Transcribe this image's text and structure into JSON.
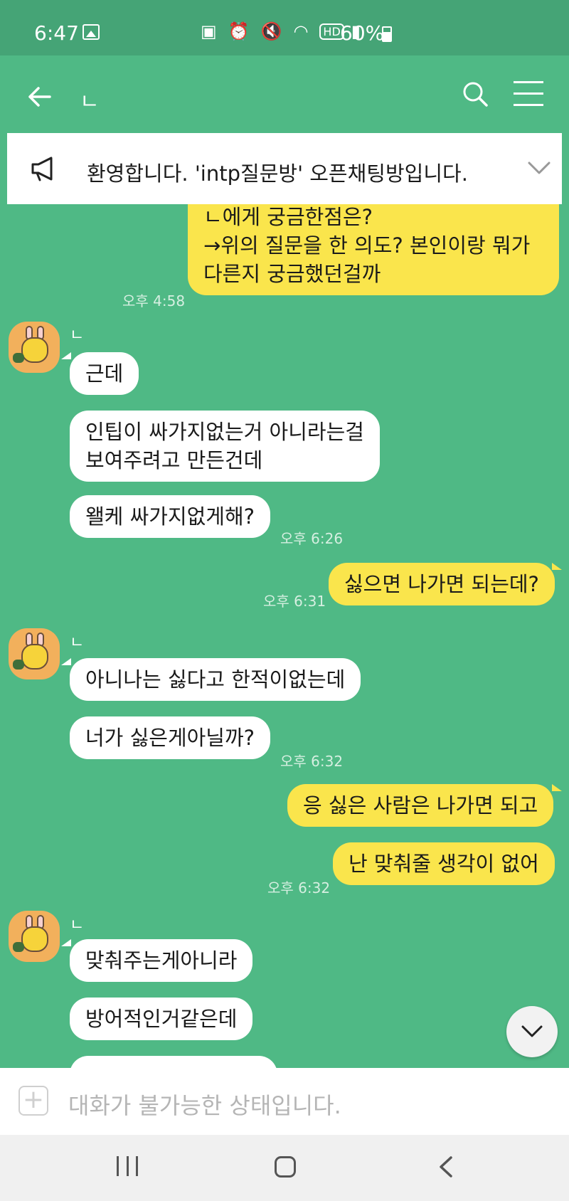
{
  "status": {
    "time": "6:47",
    "hd_label": "HD",
    "battery": "60%"
  },
  "header": {
    "title": "ㄴ"
  },
  "notice": {
    "text": "환영합니다. 'intp질문방' 오픈채팅방입니다."
  },
  "messages": {
    "m1": {
      "line1": "ㄴ에게 궁금한점은?",
      "line2": "→위의 질문을 한 의도? 본인이랑 뭐가",
      "line3": "다른지 궁금했던걸까",
      "time": "오후 4:58"
    },
    "g1": {
      "nick": "ㄴ",
      "b1": "근데",
      "b2_l1": "인팁이 싸가지없는거 아니라는걸",
      "b2_l2": "보여주려고 만든건데",
      "b3": "왤케 싸가지없게해?",
      "time": "오후 6:26"
    },
    "m2": {
      "text": "싫으면 나가면 되는데?",
      "time": "오후 6:31"
    },
    "g2": {
      "nick": "ㄴ",
      "b1": "아니나는 싫다고 한적이없는데",
      "b2": "너가 싫은게아닐까?",
      "time": "오후 6:32"
    },
    "m3": {
      "b1": "응 싫은 사람은 나가면 되고",
      "b2": "난 맞춰줄 생각이 없어",
      "time": "오후 6:32"
    },
    "g3": {
      "nick": "ㄴ",
      "b1": "맞춰주는게아니라",
      "b2": "방어적인거같은데"
    }
  },
  "composer": {
    "placeholder": "대화가 불가능한 상태입니다."
  }
}
